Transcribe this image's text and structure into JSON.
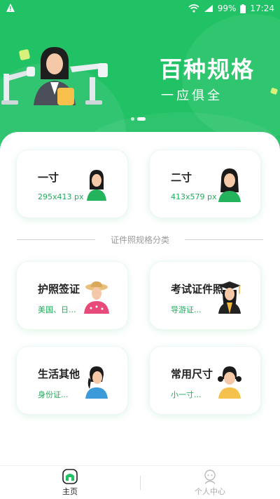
{
  "status_bar": {
    "battery": "99%",
    "time": "17:24"
  },
  "banner": {
    "title": "百种规格",
    "subtitle": "一应俱全",
    "carousel": {
      "count": 2,
      "active": 2
    }
  },
  "size_cards": [
    {
      "title": "一寸",
      "subtitle": "295x413 px",
      "icon": "woman-avatar-icon"
    },
    {
      "title": "二寸",
      "subtitle": "413x579 px",
      "icon": "woman-avatar-icon"
    }
  ],
  "section_label": "证件照规格分类",
  "category_cards": [
    {
      "title": "护照签证",
      "subtitle": "美国、日...",
      "icon": "hat-woman-icon"
    },
    {
      "title": "考试证件照",
      "subtitle": "导游证...",
      "icon": "graduate-icon"
    },
    {
      "title": "生活其他",
      "subtitle": "身份证...",
      "icon": "woman-avatar-icon"
    },
    {
      "title": "常用尺寸",
      "subtitle": "小一寸...",
      "icon": "girl-avatar-icon"
    }
  ],
  "tabs": [
    {
      "label": "主页",
      "icon": "home-icon",
      "active": true
    },
    {
      "label": "个人中心",
      "icon": "profile-icon",
      "active": false
    }
  ],
  "colors": {
    "brand": "#21c165",
    "accent_text": "#1fae5c"
  }
}
